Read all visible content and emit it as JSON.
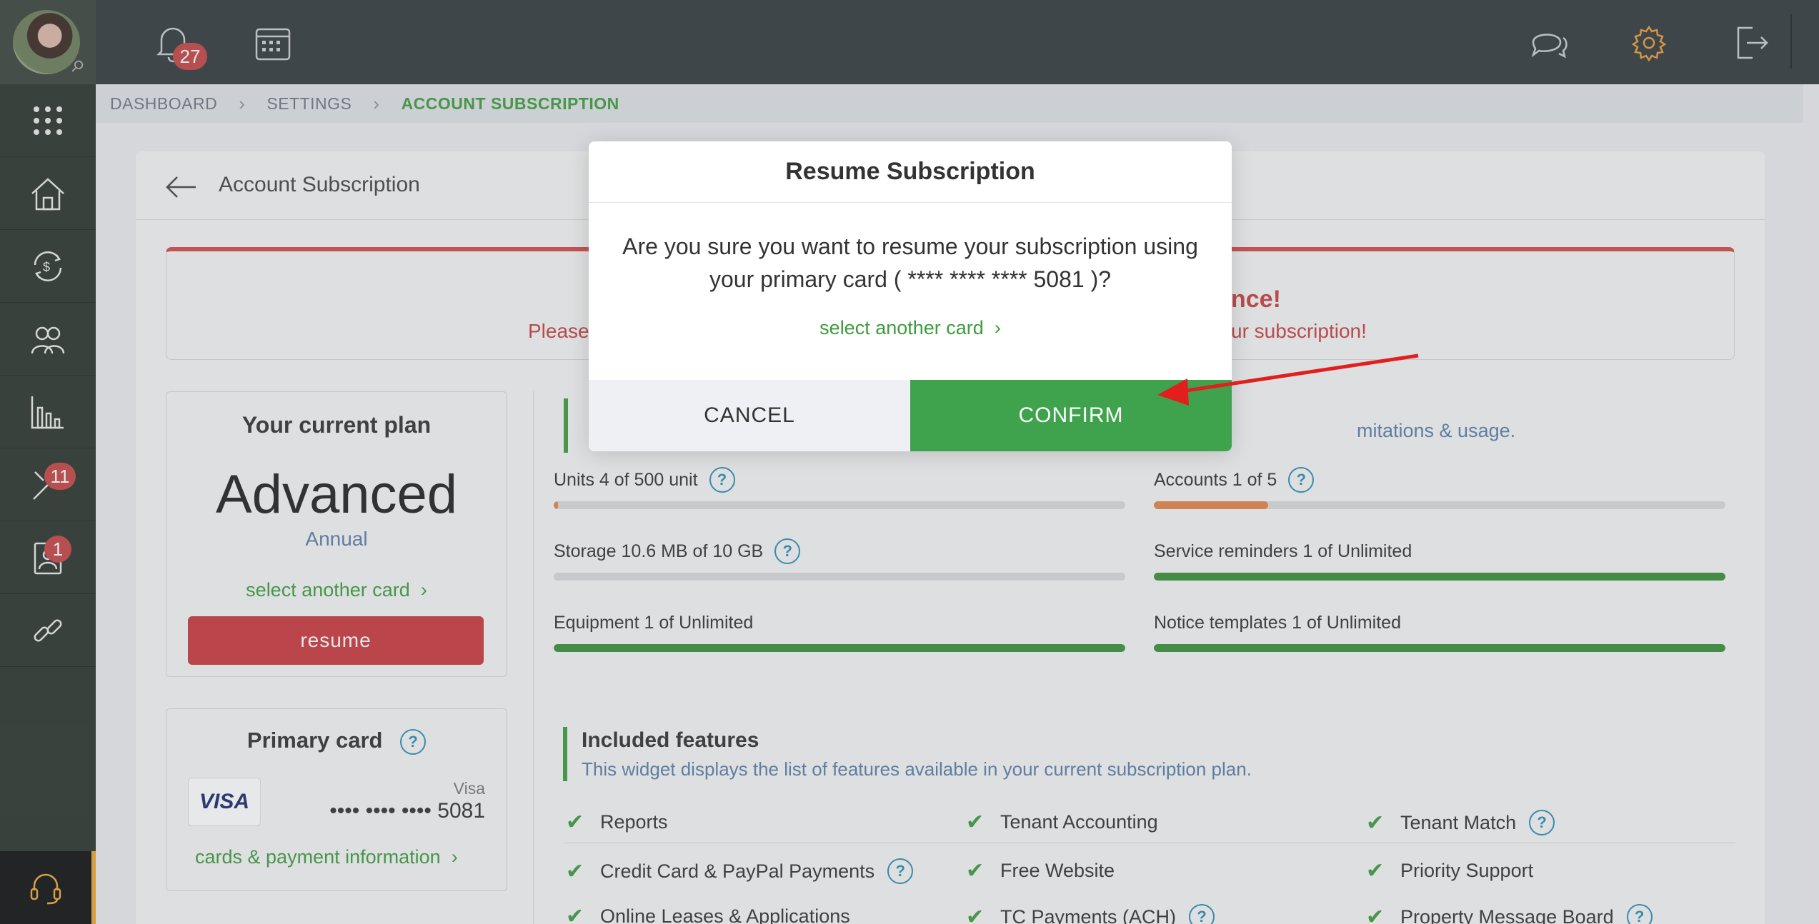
{
  "topbar": {
    "notification_count": "27",
    "icons": [
      "bell-icon",
      "calendar-icon",
      "chat-icon",
      "gear-icon",
      "logout-icon"
    ]
  },
  "sidebar": {
    "items": [
      {
        "name": "apps-grid-icon",
        "badge": ""
      },
      {
        "name": "properties-icon",
        "badge": ""
      },
      {
        "name": "accounting-icon",
        "badge": ""
      },
      {
        "name": "people-icon",
        "badge": ""
      },
      {
        "name": "reports-icon",
        "badge": ""
      },
      {
        "name": "maintenance-icon",
        "badge": "11"
      },
      {
        "name": "applications-icon",
        "badge": "1"
      },
      {
        "name": "links-icon",
        "badge": ""
      }
    ],
    "support_icon": "headset-icon"
  },
  "breadcrumb": {
    "items": [
      "DASHBOARD",
      "SETTINGS",
      "ACCOUNT SUBSCRIPTION"
    ]
  },
  "page": {
    "title": "Account Subscription",
    "alert": {
      "title_visible": "nce!",
      "left_visible": "Please",
      "right_visible": "ur subscription!"
    },
    "plan": {
      "label": "Your current plan",
      "name": "Advanced",
      "period": "Annual",
      "select_card": "select another card",
      "resume": "resume"
    },
    "primary_card": {
      "title": "Primary card",
      "brand": "VISA",
      "type": "Visa",
      "number": "•••• •••• •••• 5081",
      "link": "cards & payment information"
    },
    "usage": {
      "subtitle_visible": "mitations & usage.",
      "metrics": [
        {
          "label": "Units 4 of 500 unit",
          "help": true,
          "fill": 0.008,
          "color": "#e0844a"
        },
        {
          "label": "Accounts 1 of 5",
          "help": true,
          "fill": 0.2,
          "color": "#e0844a"
        },
        {
          "label": "Storage 10.6 MB of 10 GB",
          "help": true,
          "fill": 0.0,
          "color": "#e0844a"
        },
        {
          "label": "Service reminders 1 of Unlimited",
          "help": false,
          "fill": 1.0,
          "color": "#3a8f3a"
        },
        {
          "label": "Equipment 1 of Unlimited",
          "help": false,
          "fill": 1.0,
          "color": "#3a8f3a"
        },
        {
          "label": "Notice templates 1 of Unlimited",
          "help": false,
          "fill": 1.0,
          "color": "#3a8f3a"
        }
      ]
    },
    "features": {
      "title": "Included features",
      "subtitle": "This widget displays the list of features available in your current subscription plan.",
      "items": [
        {
          "label": "Reports",
          "help": false
        },
        {
          "label": "Tenant Accounting",
          "help": false
        },
        {
          "label": "Tenant Match",
          "help": true
        },
        {
          "label": "Credit Card & PayPal Payments",
          "help": true
        },
        {
          "label": "Free Website",
          "help": false
        },
        {
          "label": "Priority Support",
          "help": false
        },
        {
          "label": "Online Leases & Applications",
          "help": false
        },
        {
          "label": "TC Payments (ACH)",
          "help": true
        },
        {
          "label": "Property Message Board",
          "help": true
        }
      ]
    }
  },
  "modal": {
    "title": "Resume Subscription",
    "message": "Are you sure you want to resume your subscription using your primary card ( **** **** **** 5081 )?",
    "select_card": "select another card",
    "cancel": "CANCEL",
    "confirm": "CONFIRM"
  },
  "colors": {
    "accent_green": "#3fa34d",
    "danger_red": "#c9393d",
    "sidebar_bg": "#2b342c",
    "topbar_bg": "#323a3c",
    "link_blue": "#2d8fb5"
  }
}
